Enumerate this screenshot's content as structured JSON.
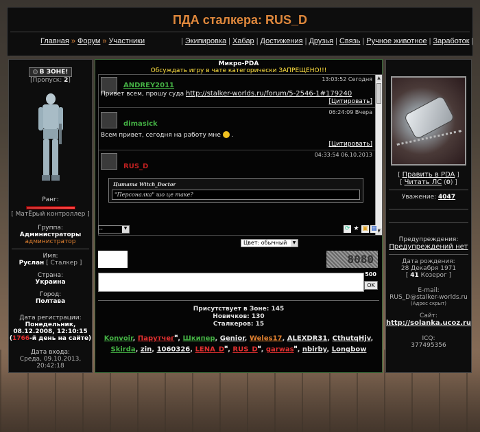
{
  "header": {
    "title": "ПДА сталкера: RUS_D",
    "nav_left": [
      "Главная",
      "Форум",
      "Участники"
    ],
    "nav_sep": "»",
    "nav_right": [
      "Экипировка",
      "Хабар",
      "Достижения",
      "Друзья",
      "Связь",
      "Ручное животное",
      "Заработок"
    ]
  },
  "left": {
    "status": "В ЗОНЕ!",
    "passes_label": "[Пропуск:",
    "passes_value": "2",
    "passes_close": "]",
    "rank_label": "Ранг:",
    "rank_value": "[ МатЁрый контроллер ]",
    "group_label": "Группа:",
    "group_line1": "Администраторы",
    "group_line2": "администратор",
    "name_label": "Имя:",
    "name_value": "Руслан",
    "name_extra": "[ Сталкер ]",
    "country_label": "Страна:",
    "country_value": "Украина",
    "city_label": "Город:",
    "city_value": "Полтава",
    "reg_label": "Дата регистрации:",
    "reg_line1": "Понедельник,",
    "reg_line2": "08.12.2008, 12:10:15",
    "reg_days": "1766",
    "reg_days_suffix": "-й день на сайте)",
    "reg_days_prefix": "(",
    "login_label": "Дата входа:",
    "login_line1": "Среда, 09.10.2013,",
    "login_line2": "20:42:18"
  },
  "pda": {
    "title": "Микро-PDA",
    "warning": "Обсуждать игру в чате категорически ЗАПРЕЩЕНО!!!",
    "messages": [
      {
        "time": "13:03:52 Сегодня",
        "nick": "ANDREY2011",
        "text": "Привет всем, прошу суда",
        "link": "http://stalker-worlds.ru/forum/5-2546-1#179240",
        "cite": "[Цитировать]"
      },
      {
        "time": "06:24:09 Вчера",
        "nick": "dimasick",
        "text": "Всем привет, сегодня на работу мне",
        "cite": "[Цитировать]"
      },
      {
        "time": "04:33:54 06.10.2013",
        "nick": "RUS_D",
        "quote_head": "Цитата Witch_Doctor",
        "quote_text": "\"Персоналка\" шо це таке?"
      }
    ],
    "smiles_select": "--",
    "color_select": "Цвет: обычный",
    "captcha": "8080",
    "char_count": "500",
    "ok_label": "OK"
  },
  "online": {
    "present": "Присутствует в Зоне: 145",
    "newbies": "Новичков: 130",
    "stalkers": "Сталкеров: 15",
    "users": [
      {
        "name": "Konvoir",
        "color": "#44b044"
      },
      {
        "name": "Парутчег",
        "color": "#e03030",
        "mark": "м"
      },
      {
        "name": "Шкипер",
        "color": "#44b044"
      },
      {
        "name": "Genior",
        "color": "#e8e8e8"
      },
      {
        "name": "Weles17",
        "color": "#e08030"
      },
      {
        "name": "ALEXDR31",
        "color": "#e8e8e8"
      },
      {
        "name": "CthutqHjv",
        "color": "#e8e8e8"
      },
      {
        "name": "Skirda",
        "color": "#44b044"
      },
      {
        "name": "zin",
        "color": "#e8e8e8"
      },
      {
        "name": "1060326",
        "color": "#e8e8e8"
      },
      {
        "name": "LENA_D",
        "color": "#e03030",
        "mark": "м"
      },
      {
        "name": "RUS_D",
        "color": "#e03030",
        "mark": "м"
      },
      {
        "name": "garwas",
        "color": "#e03030",
        "mark": "м"
      },
      {
        "name": "nbirby",
        "color": "#e8e8e8"
      },
      {
        "name": "Longbow",
        "color": "#e8e8e8"
      }
    ]
  },
  "right": {
    "edit_pda": "Править в PDA",
    "read_pm": "Читать ЛС",
    "pm_count": "0",
    "respect_label": "Уважение:",
    "respect_value": "4047",
    "warn_label": "Предупреждения:",
    "warn_value": "Предупреждений нет",
    "birth_label": "Дата рождения:",
    "birth_value": "28 Декабря 1971",
    "age_value": "41",
    "zodiac": "Козерог",
    "email_label": "E-mail:",
    "email_value": "RUS_D@stalker-worlds.ru",
    "email_note": "(Адрес скрыт)",
    "site_label": "Сайт:",
    "site_value": "http://solanka.ucoz.ru",
    "icq_label": "ICQ:",
    "icq_value": "377495356"
  }
}
